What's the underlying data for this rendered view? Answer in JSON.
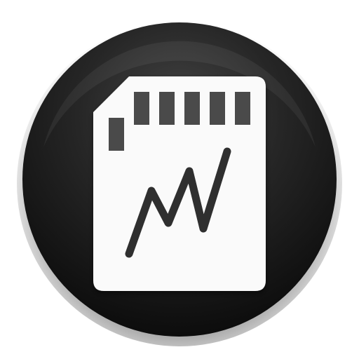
{
  "icon": {
    "name": "sd-card-speed-icon",
    "colors": {
      "circle_dark": "#0e0e0e",
      "circle_mid": "#3a3a3a",
      "circle_edge": "#1a1a1a",
      "card_fill": "#fafafa",
      "contact_fill": "#4a4a4a",
      "graph_stroke": "#2f2f2f"
    }
  }
}
